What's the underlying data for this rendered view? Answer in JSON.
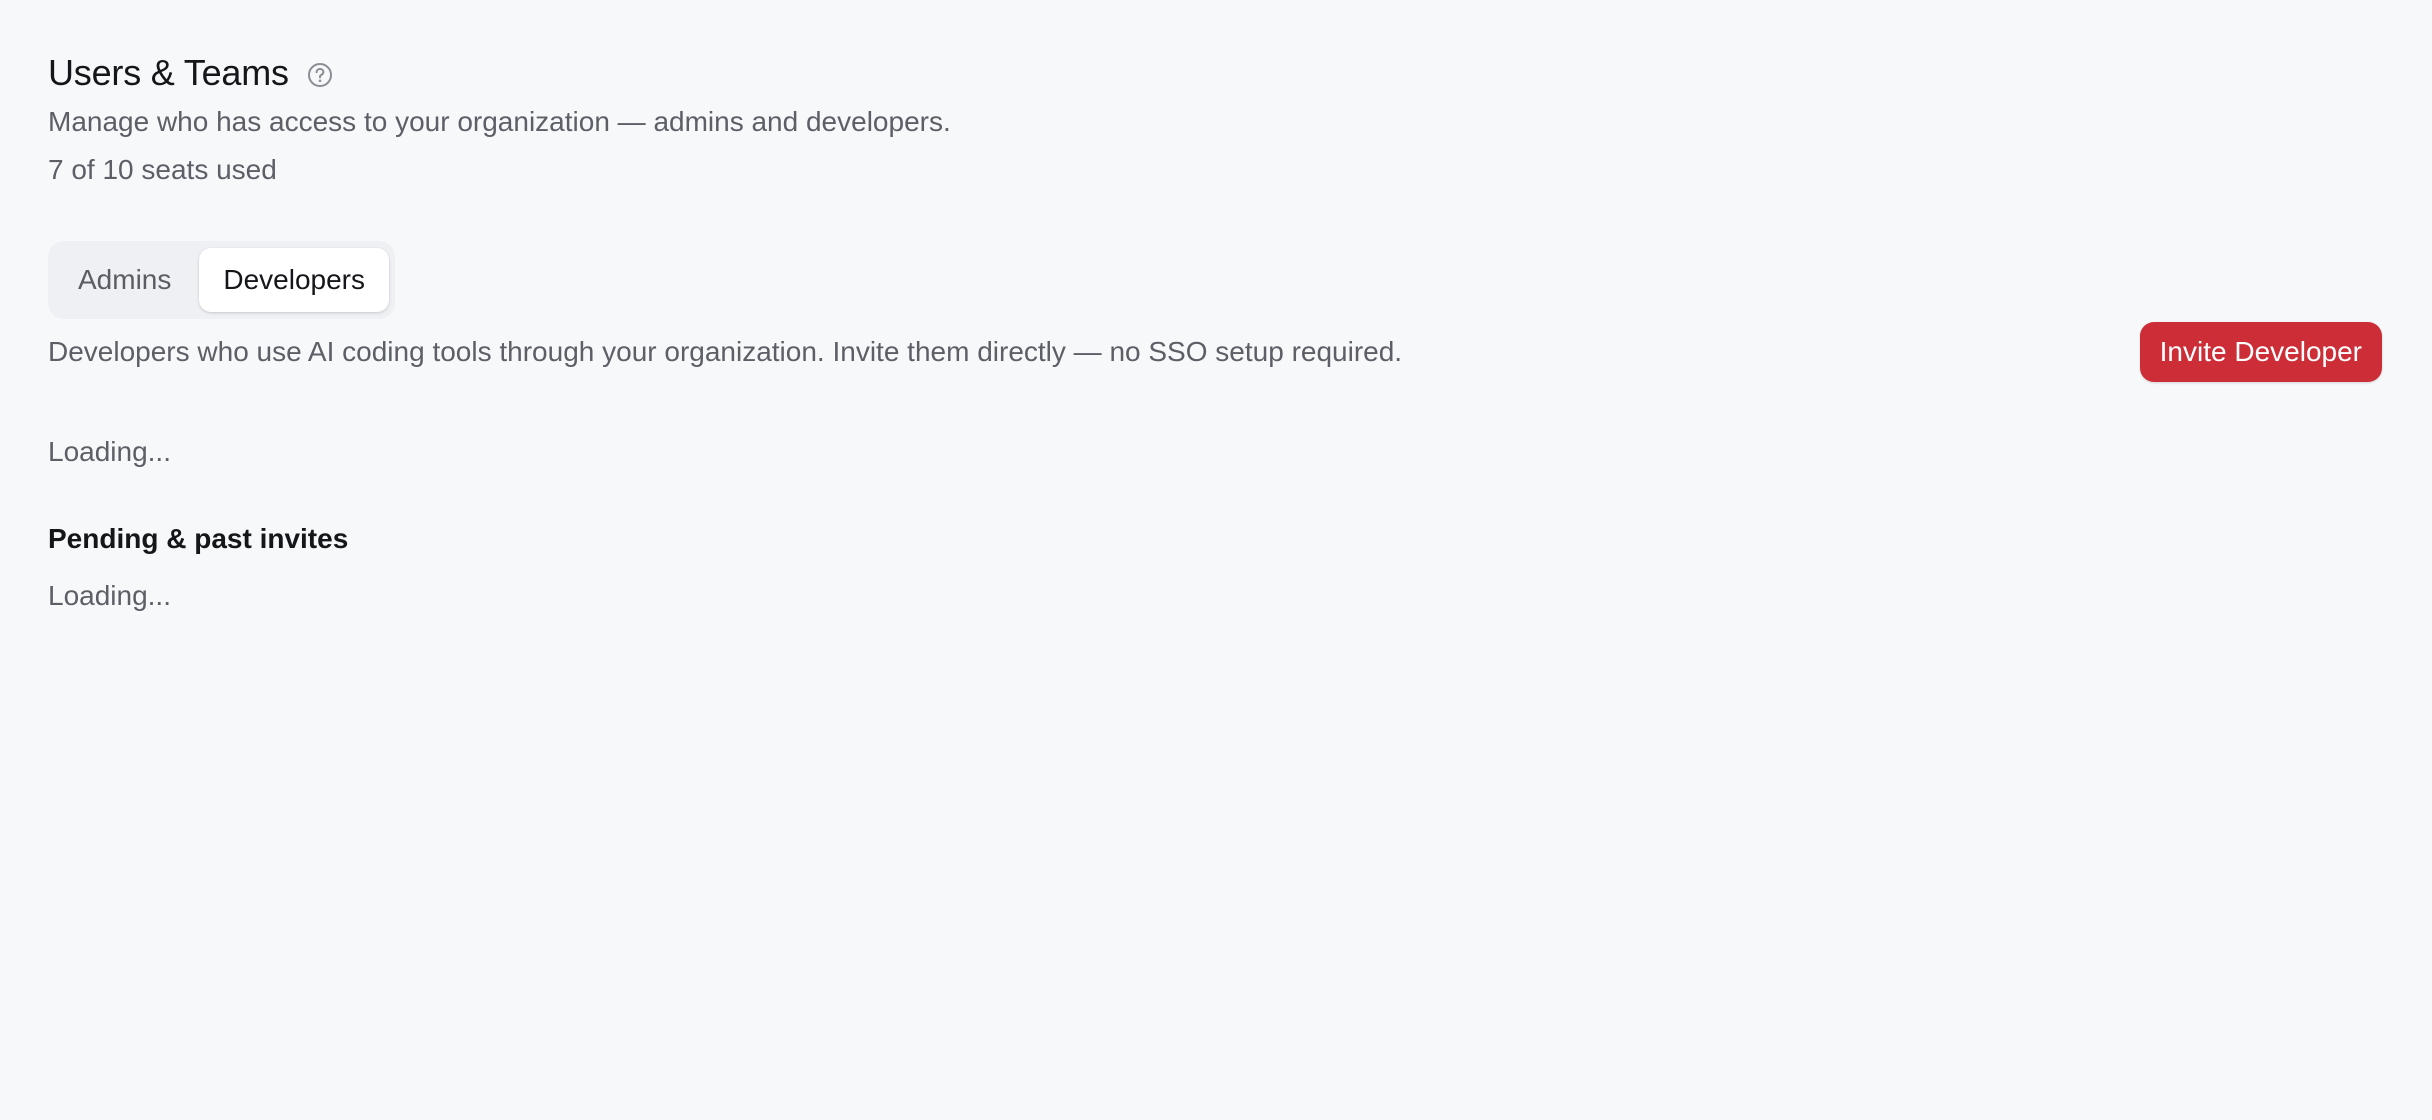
{
  "header": {
    "title": "Users & Teams",
    "help_icon": "question-circle-icon",
    "subtitle": "Manage who has access to your organization — admins and developers.",
    "seats": "7 of 10 seats used"
  },
  "tabs": [
    {
      "label": "Admins",
      "active": false
    },
    {
      "label": "Developers",
      "active": true
    }
  ],
  "developers": {
    "description": "Developers who use AI coding tools through your organization. Invite them directly — no SSO setup required.",
    "invite_button": "Invite Developer",
    "loading": "Loading..."
  },
  "invites": {
    "title": "Pending & past invites",
    "loading": "Loading..."
  },
  "colors": {
    "background": "#f7f8fa",
    "accent": "#cc2d37",
    "text_primary": "#15161a",
    "text_secondary": "#5c5f66"
  }
}
